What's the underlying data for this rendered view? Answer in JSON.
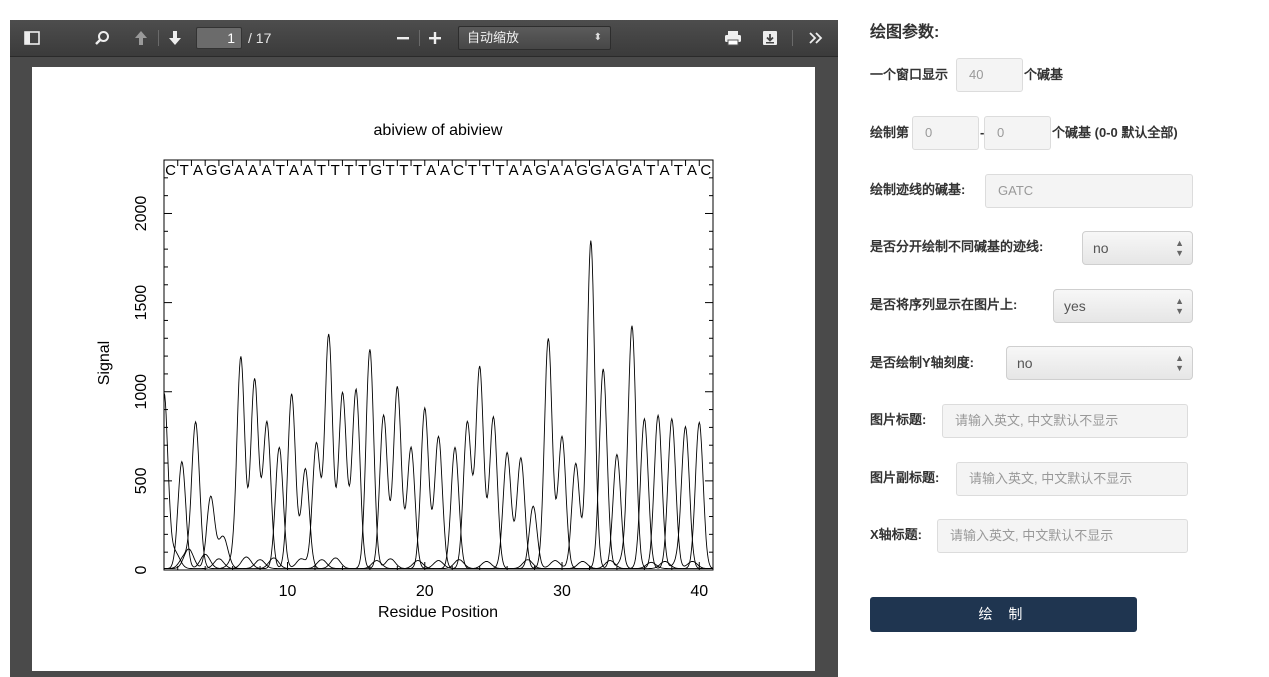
{
  "viewer": {
    "page_current": "1",
    "page_total": "/ 17",
    "zoom_label": "自动缩放"
  },
  "chart_data": {
    "type": "line",
    "title": "abiview of abiview",
    "xlabel": "Residue Position",
    "ylabel": "Signal",
    "xlim": [
      1,
      41
    ],
    "ylim": [
      0,
      2300
    ],
    "x_ticks": [
      10,
      20,
      30,
      40
    ],
    "y_ticks": [
      0,
      500,
      1000,
      1500,
      2000
    ],
    "sequence": "CTAGGAAATAATTTTGTTTAACTTTAAGAAGGAGATATAC",
    "peaks": [
      {
        "pos": 1.0,
        "height": 980,
        "base": "C"
      },
      {
        "pos": 2.3,
        "height": 600,
        "base": "T"
      },
      {
        "pos": 3.3,
        "height": 760,
        "base": "A"
      },
      {
        "pos": 4.4,
        "height": 400,
        "base": "G"
      },
      {
        "pos": 5.3,
        "height": 180,
        "base": "G"
      },
      {
        "pos": 6.6,
        "height": 1180,
        "base": "A"
      },
      {
        "pos": 7.6,
        "height": 1060,
        "base": "A"
      },
      {
        "pos": 8.5,
        "height": 820,
        "base": "A"
      },
      {
        "pos": 9.4,
        "height": 680,
        "base": "T"
      },
      {
        "pos": 10.3,
        "height": 980,
        "base": "A"
      },
      {
        "pos": 11.3,
        "height": 560,
        "base": "A"
      },
      {
        "pos": 12.1,
        "height": 700,
        "base": "T"
      },
      {
        "pos": 13.0,
        "height": 1310,
        "base": "T"
      },
      {
        "pos": 14.0,
        "height": 960,
        "base": "T"
      },
      {
        "pos": 15.0,
        "height": 980,
        "base": "T"
      },
      {
        "pos": 16.0,
        "height": 1230,
        "base": "G"
      },
      {
        "pos": 17.0,
        "height": 860,
        "base": "T"
      },
      {
        "pos": 18.0,
        "height": 1020,
        "base": "T"
      },
      {
        "pos": 19.0,
        "height": 680,
        "base": "T"
      },
      {
        "pos": 20.0,
        "height": 900,
        "base": "A"
      },
      {
        "pos": 21.0,
        "height": 740,
        "base": "A"
      },
      {
        "pos": 22.2,
        "height": 680,
        "base": "C"
      },
      {
        "pos": 23.1,
        "height": 820,
        "base": "T"
      },
      {
        "pos": 24.0,
        "height": 1130,
        "base": "T"
      },
      {
        "pos": 25.0,
        "height": 850,
        "base": "T"
      },
      {
        "pos": 26.0,
        "height": 600,
        "base": "A"
      },
      {
        "pos": 27.0,
        "height": 620,
        "base": "A"
      },
      {
        "pos": 27.9,
        "height": 350,
        "base": "G"
      },
      {
        "pos": 29.0,
        "height": 1290,
        "base": "A"
      },
      {
        "pos": 30.0,
        "height": 740,
        "base": "A"
      },
      {
        "pos": 31.0,
        "height": 590,
        "base": "G"
      },
      {
        "pos": 32.1,
        "height": 1840,
        "base": "G"
      },
      {
        "pos": 33.0,
        "height": 1120,
        "base": "A"
      },
      {
        "pos": 34.0,
        "height": 640,
        "base": "G"
      },
      {
        "pos": 35.1,
        "height": 1350,
        "base": "A"
      },
      {
        "pos": 36.0,
        "height": 840,
        "base": "T"
      },
      {
        "pos": 37.0,
        "height": 860,
        "base": "A"
      },
      {
        "pos": 38.0,
        "height": 840,
        "base": "T"
      },
      {
        "pos": 39.0,
        "height": 780,
        "base": "A"
      },
      {
        "pos": 40.0,
        "height": 820,
        "base": "C"
      }
    ]
  },
  "form": {
    "title": "绘图参数:",
    "window_label_pre": "一个窗口显示",
    "window_value": "40",
    "window_label_post": "个碱基",
    "range_label_pre": "绘制第",
    "range_start": "0",
    "range_dash": "-",
    "range_end": "0",
    "range_label_post": "个碱基 (0-0 默认全部)",
    "trace_label": "绘制迹线的碱基:",
    "trace_value": "GATC",
    "separate_label": "是否分开绘制不同碱基的迹线:",
    "separate_value": "no",
    "show_seq_label": "是否将序列显示在图片上:",
    "show_seq_value": "yes",
    "yticks_label": "是否绘制Y轴刻度:",
    "yticks_value": "no",
    "img_title_label": "图片标题:",
    "img_title_placeholder": "请输入英文, 中文默认不显示",
    "img_subtitle_label": "图片副标题:",
    "img_subtitle_placeholder": "请输入英文, 中文默认不显示",
    "xaxis_label": "X轴标题:",
    "xaxis_placeholder": "请输入英文, 中文默认不显示",
    "draw_button": "绘 制"
  }
}
